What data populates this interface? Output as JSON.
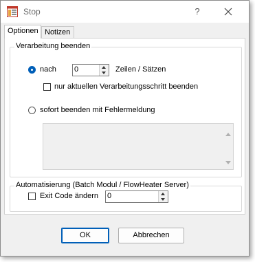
{
  "window": {
    "title": "Stop",
    "help_label": "?"
  },
  "tabs": [
    {
      "label": "Optionen",
      "active": true
    },
    {
      "label": "Notizen",
      "active": false
    }
  ],
  "group_processing": {
    "title": "Verarbeitung beenden",
    "after_option": {
      "label": "nach",
      "selected": true,
      "spin_value": "0",
      "unit_label": "Zeilen / Sätzen"
    },
    "current_step_checkbox": {
      "label": "nur aktuellen Verarbeitungsschritt beenden",
      "checked": false
    },
    "immediate_option": {
      "label": "sofort beenden mit Fehlermeldung",
      "selected": false
    },
    "error_message_value": ""
  },
  "group_automation": {
    "title": "Automatisierung (Batch Modul / FlowHeater Server)",
    "exit_code_checkbox": {
      "label": "Exit Code ändern",
      "checked": false
    },
    "exit_code_value": "0"
  },
  "footer": {
    "ok_label": "OK",
    "cancel_label": "Abbrechen"
  },
  "colors": {
    "accent": "#005fb8",
    "dialog_bg": "#f0f0f0",
    "title_text": "#6b6b6b"
  }
}
